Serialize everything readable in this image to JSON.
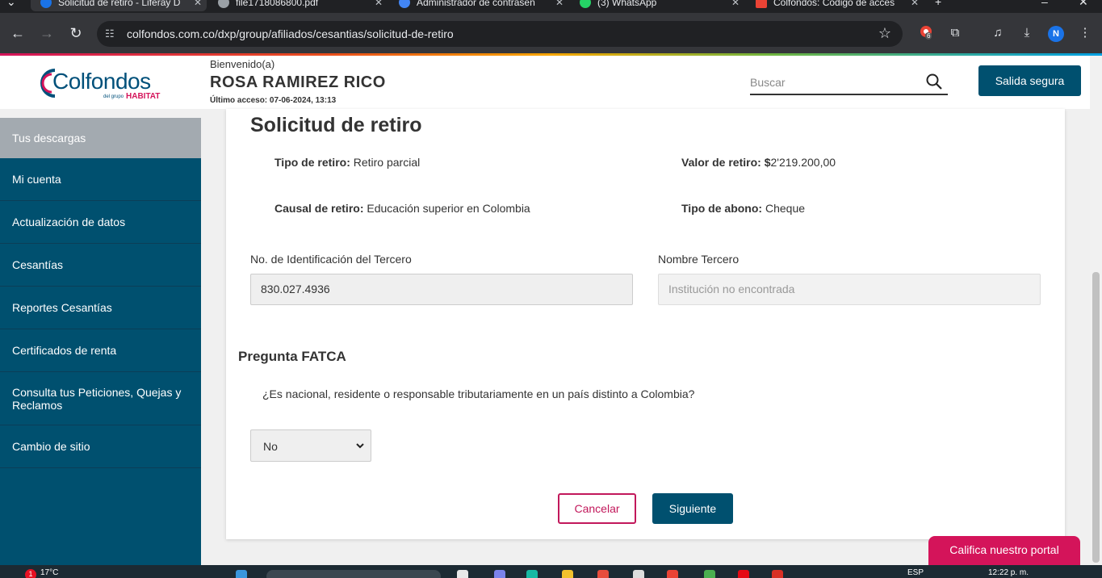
{
  "browser": {
    "tabs": [
      {
        "title": "Solicitud de retiro - Liferay D",
        "active": true,
        "favicon_color": "#1a73e8"
      },
      {
        "title": "file1718086800.pdf",
        "active": false,
        "favicon_color": "#9aa0a6"
      },
      {
        "title": "Administrador de contraseñ",
        "active": false,
        "favicon_color": "#4285f4"
      },
      {
        "title": "(3) WhatsApp",
        "active": false,
        "favicon_color": "#25d366"
      },
      {
        "title": "Colfondos: Código de acces",
        "active": false,
        "favicon_color": "#ea4335"
      }
    ],
    "url": "colfondos.com.co/dxp/group/afiliados/cesantias/solicitud-de-retiro",
    "extension_badge": "6",
    "profile_initial": "N"
  },
  "header": {
    "logo_text": "Colfondos",
    "logo_sub": "del grupo",
    "logo_brand": "HABITAT",
    "welcome": "Bienvenido(a)",
    "user_name": "ROSA RAMIREZ RICO",
    "last_access": "Último acceso: 07-06-2024, 13:13",
    "search_placeholder": "Buscar",
    "logout_label": "Salida segura"
  },
  "sidebar": {
    "items": [
      {
        "label": "Tus descargas",
        "active": true
      },
      {
        "label": "Mi cuenta"
      },
      {
        "label": "Actualización de datos"
      },
      {
        "label": "Cesantías"
      },
      {
        "label": "Reportes Cesantías"
      },
      {
        "label": "Certificados de renta"
      },
      {
        "label": "Consulta tus Peticiones, Quejas y Reclamos"
      },
      {
        "label": "Cambio de sitio"
      }
    ]
  },
  "form": {
    "title": "Solicitud de retiro",
    "tipo_retiro_label": "Tipo de retiro:",
    "tipo_retiro_value": "Retiro parcial",
    "valor_retiro_label": "Valor de retiro:",
    "valor_retiro_currency": "$",
    "valor_retiro_value": "2'219.200,00",
    "causal_label": "Causal de retiro:",
    "causal_value": "Educación superior en Colombia",
    "tipo_abono_label": "Tipo de abono:",
    "tipo_abono_value": "Cheque",
    "id_tercero_label": "No. de Identificación del Tercero",
    "id_tercero_value": "830.027.4936",
    "nombre_tercero_label": "Nombre Tercero",
    "nombre_tercero_value": "Institución no encontrada",
    "fatca_title": "Pregunta FATCA",
    "fatca_question": "¿Es nacional, residente o responsable tributariamente en un país distinto a Colombia?",
    "fatca_answer": "No",
    "cancel_label": "Cancelar",
    "next_label": "Siguiente"
  },
  "rate_portal_label": "Califica nuestro portal",
  "taskbar": {
    "notification_count": "1",
    "temperature": "17°C",
    "language": "ESP",
    "time": "12:22 p. m."
  },
  "colors": {
    "primary": "#00506f",
    "accent": "#d4145a",
    "sidebar_active": "#a3aab0"
  }
}
